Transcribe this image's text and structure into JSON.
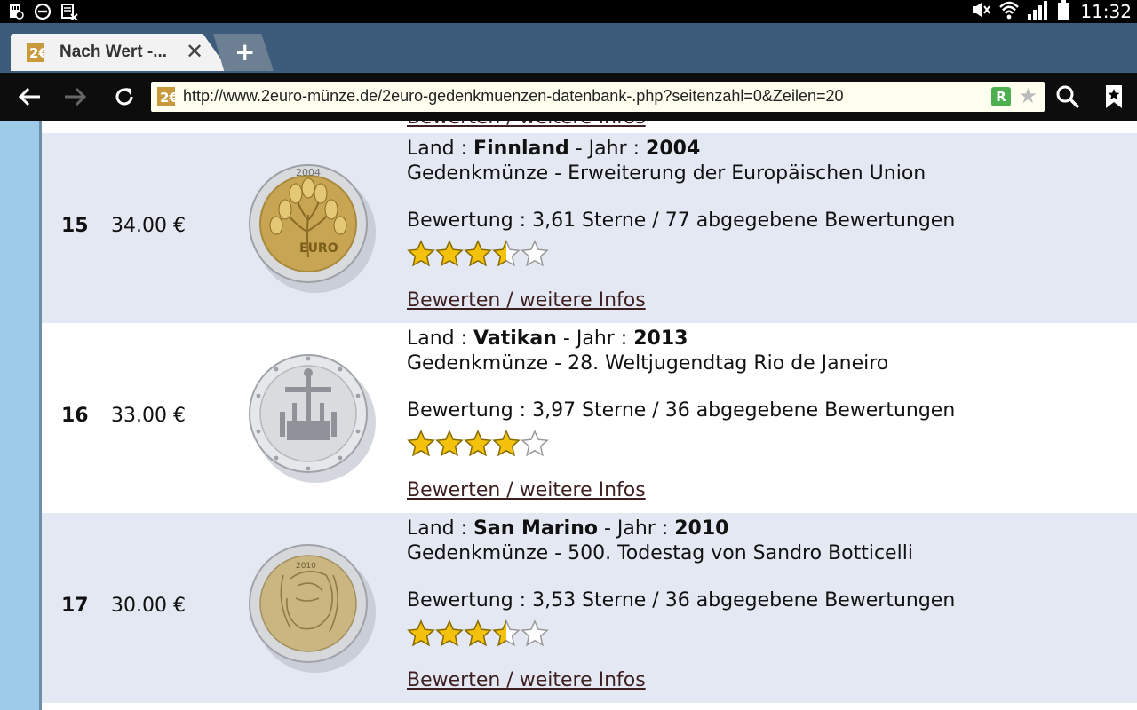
{
  "status_bar": {
    "time": "11:32",
    "left_icons": [
      "sd-card-icon",
      "do-not-disturb-icon",
      "blocked-app-icon"
    ],
    "right_icons": [
      "mute-icon",
      "wifi-icon",
      "signal-icon",
      "battery-icon"
    ]
  },
  "tab": {
    "title": "Nach Wert -...",
    "close_glyph": "✕",
    "new_tab_glyph": "+"
  },
  "toolbar": {
    "url": "http://www.2euro-münze.de/2euro-gedenkmuenzen-datenbank-.php?seitenzahl=0&Zeilen=20",
    "extension_glyph": "R"
  },
  "page": {
    "previous_link": "Bewerten / weitere Infos",
    "rows": [
      {
        "rank": "15",
        "price": "34.00 €",
        "land_label": "Land : ",
        "land": "Finnland",
        "jahr_label": " - Jahr : ",
        "jahr": "2004",
        "description": "Gedenkmünze - Erweiterung der Europäischen Union",
        "rating_text": "Bewertung : 3,61 Sterne / 77 abgegebene Bewertungen",
        "rating_value": 3.61,
        "link": "Bewerten / weitere Infos",
        "coin_icon": "coin-finland-2004"
      },
      {
        "rank": "16",
        "price": "33.00 €",
        "land_label": "Land : ",
        "land": "Vatikan",
        "jahr_label": " - Jahr : ",
        "jahr": "2013",
        "description": "Gedenkmünze - 28. Weltjugendtag Rio de Janeiro",
        "rating_text": "Bewertung : 3,97 Sterne / 36 abgegebene Bewertungen",
        "rating_value": 3.97,
        "link": "Bewerten / weitere Infos",
        "coin_icon": "coin-vatican-2013"
      },
      {
        "rank": "17",
        "price": "30.00 €",
        "land_label": "Land : ",
        "land": "San Marino",
        "jahr_label": " - Jahr : ",
        "jahr": "2010",
        "description": "Gedenkmünze - 500. Todestag von Sandro Botticelli",
        "rating_text": "Bewertung : 3,53 Sterne / 36 abgegebene Bewertungen",
        "rating_value": 3.53,
        "link": "Bewerten / weitere Infos",
        "coin_icon": "coin-san-marino-2010"
      }
    ]
  },
  "colors": {
    "tab_strip": "#3d5c7c",
    "row_shaded": "#e3e8f2",
    "sidebar": "#9ecbea",
    "link": "#3d1f1f",
    "star_gold": "#f4c20d"
  }
}
